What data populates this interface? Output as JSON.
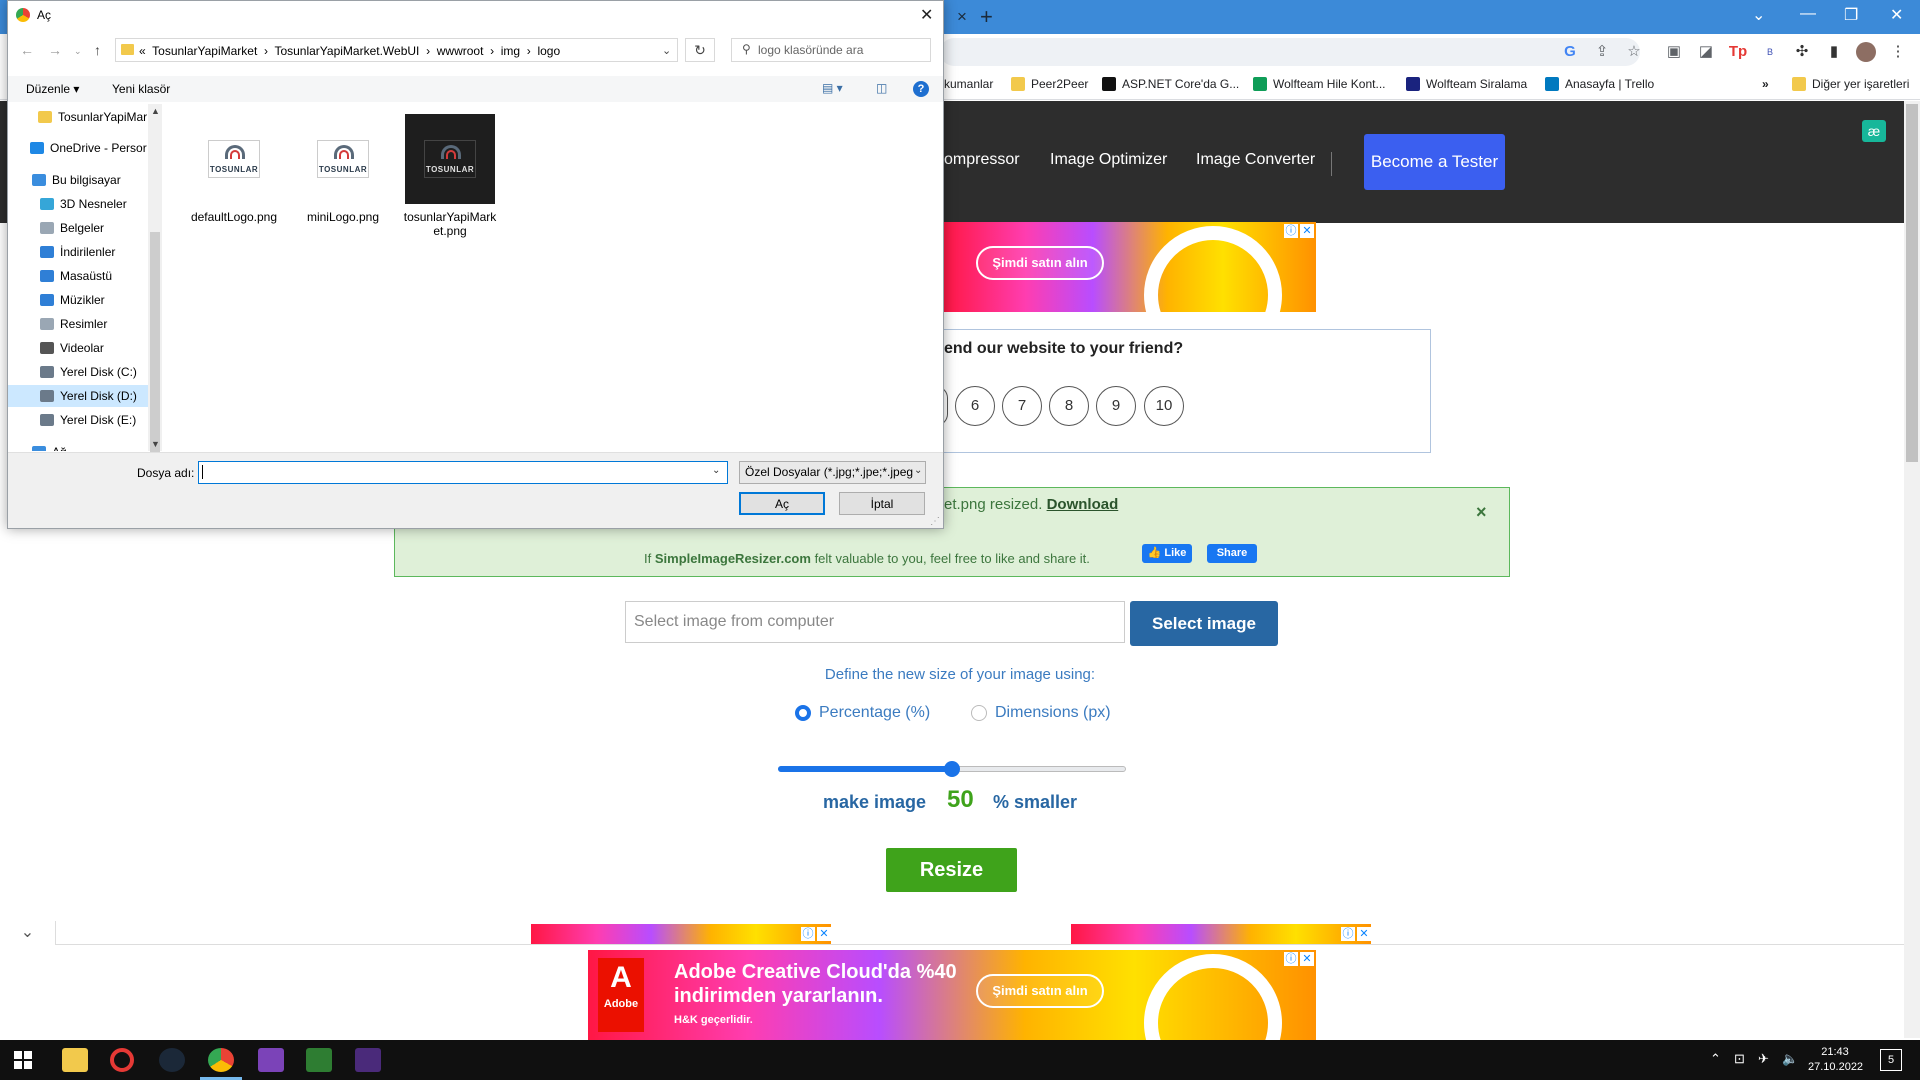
{
  "browser": {
    "bookmarks": [
      "kumanlar",
      "Peer2Peer",
      "ASP.NET Core'da G...",
      "Wolfteam Hile Kont...",
      "Wolfteam Siralama",
      "Anasayfa | Trello"
    ],
    "bookmarks_more": "»",
    "other_bookmarks": "Diğer yer işaretleri",
    "new_tab": "+",
    "tab_close": "×"
  },
  "site": {
    "nav": [
      "ompressor",
      "Image Optimizer",
      "Image Converter"
    ],
    "become_tester": "Become a Tester",
    "ad_top_button": "Şimdi satın alın",
    "recommend_question": "end our website to your friend?",
    "ratings": [
      "6",
      "7",
      "8",
      "9",
      "10"
    ],
    "alert": {
      "filename_tail": "et.png resized.",
      "download": "Download",
      "close": "×",
      "share_prefix": "If",
      "share_brand": "SimpleImageResizer.com",
      "share_suffix": "felt valuable to you, feel free to like and share it.",
      "like": "Like",
      "share": "Share"
    },
    "file_input_placeholder": "Select image from computer",
    "select_image": "Select image",
    "define_size": "Define the new size of your image using:",
    "option_percentage": "Percentage (%)",
    "option_dimensions": "Dimensions (px)",
    "selected_option": "Percentage (%)",
    "slider_percent": 50,
    "make_image": "make image",
    "percent_value": "50",
    "smaller": "% smaller",
    "resize": "Resize",
    "ad_bottom": {
      "brand": "Adobe",
      "headline": "Adobe Creative Cloud'da %40 indirimden yararlanın.",
      "sub": "H&K geçerlidir.",
      "button": "Şimdi satın alın"
    },
    "shelf_toggle": "⌄"
  },
  "dialog": {
    "title": "Aç",
    "close": "✕",
    "path": [
      "«",
      "TosunlarYapiMarket",
      "›",
      "TosunlarYapiMarket.WebUI",
      "›",
      "wwwroot",
      "›",
      "img",
      "›",
      "logo"
    ],
    "search_placeholder": "logo klasöründe ara",
    "organize": "Düzenle ▾",
    "new_folder": "Yeni klasör",
    "help": "?",
    "nav_items": [
      {
        "label": "TosunlarYapiMar",
        "color": "#f2c94c"
      },
      {
        "label": "OneDrive - Persor",
        "color": "#1e88e5"
      },
      {
        "label": "Bu bilgisayar",
        "color": "#3a8dde"
      },
      {
        "label": "3D Nesneler",
        "color": "#35a6d8"
      },
      {
        "label": "Belgeler",
        "color": "#9aa7b4"
      },
      {
        "label": "İndirilenler",
        "color": "#2f7fd6"
      },
      {
        "label": "Masaüstü",
        "color": "#2f7fd6"
      },
      {
        "label": "Müzikler",
        "color": "#2f7fd6"
      },
      {
        "label": "Resimler",
        "color": "#9aa7b4"
      },
      {
        "label": "Videolar",
        "color": "#555555"
      },
      {
        "label": "Yerel Disk (C:)",
        "color": "#6b7a8a"
      },
      {
        "label": "Yerel Disk (D:)",
        "color": "#6b7a8a"
      },
      {
        "label": "Yerel Disk (E:)",
        "color": "#6b7a8a"
      },
      {
        "label": "Ağ",
        "color": "#3a8dde"
      }
    ],
    "selected_nav": "Yerel Disk (D:)",
    "files": [
      {
        "name": "defaultLogo.png",
        "thumb": "TOSUNLAR",
        "dark": false
      },
      {
        "name": "miniLogo.png",
        "thumb": "TOSUNLAR",
        "dark": false
      },
      {
        "name": "tosunlarYapiMarket.png",
        "thumb": "TOSUNLAR",
        "dark": true
      }
    ],
    "filename_label": "Dosya adı:",
    "filename_value": "",
    "filetype": "Özel Dosyalar (*.jpg;*.jpe;*.jpeg",
    "open": "Aç",
    "cancel": "İptal"
  },
  "taskbar": {
    "time": "21:43",
    "date": "27.10.2022",
    "notifications": "5"
  }
}
